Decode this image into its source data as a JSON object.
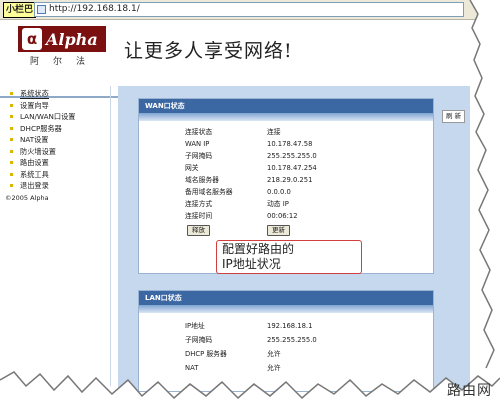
{
  "address_bar": {
    "label": "小栏巴",
    "url": "http://192.168.18.1/"
  },
  "header": {
    "logo_text": "Alpha",
    "logo_cn": "阿尔法",
    "slogan": "让更多人享受网络!"
  },
  "sidebar": {
    "items": [
      {
        "label": "系统状态",
        "active": true
      },
      {
        "label": "设置向导"
      },
      {
        "label": "LAN/WAN口设置"
      },
      {
        "label": "DHCP服务器"
      },
      {
        "label": "NAT设置"
      },
      {
        "label": "防火墙设置"
      },
      {
        "label": "路由设置"
      },
      {
        "label": "系统工具"
      },
      {
        "label": "退出登录"
      }
    ],
    "copyright": "©2005 Alpha"
  },
  "wan": {
    "title": "WAN口状态",
    "rows": [
      {
        "key": "连接状态",
        "value": "连接"
      },
      {
        "key": "WAN IP",
        "value": "10.178.47.58"
      },
      {
        "key": "子网掩码",
        "value": "255.255.255.0"
      },
      {
        "key": "网关",
        "value": "10.178.47.254"
      },
      {
        "key": "域名服务器",
        "value": "218.29.0.251"
      },
      {
        "key": "备用域名服务器",
        "value": "0.0.0.0"
      },
      {
        "key": "连接方式",
        "value": "动态 IP"
      },
      {
        "key": "连接时间",
        "value": "00:06:12"
      }
    ],
    "release_button": "释放",
    "renew_button": "更新"
  },
  "lan": {
    "title": "LAN口状态",
    "rows": [
      {
        "key": "IP地址",
        "value": "192.168.18.1"
      },
      {
        "key": "子网掩码",
        "value": "255.255.255.0"
      },
      {
        "key": "DHCP 服务器",
        "value": "允许"
      },
      {
        "key": "NAT",
        "value": "允许"
      }
    ]
  },
  "side_button": "刷 新",
  "callout": {
    "line1": "配置好路由的",
    "line2": "IP地址状况"
  },
  "watermark": "路由网"
}
